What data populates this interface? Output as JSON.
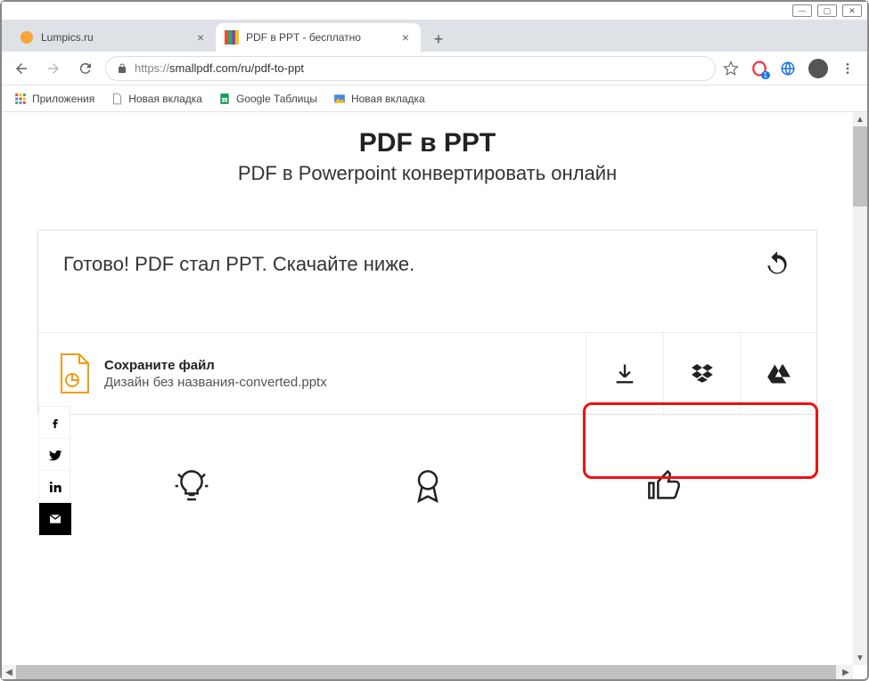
{
  "window": {
    "minimize": "—",
    "maximize": "▢",
    "close": "✕"
  },
  "tabs": [
    {
      "title": "Lumpics.ru"
    },
    {
      "title": "PDF в PPT - бесплатно"
    }
  ],
  "toolbar": {
    "url_prefix": "https://",
    "url_rest": "smallpdf.com/ru/pdf-to-ppt"
  },
  "bookmarks": {
    "apps": "Приложения",
    "newtab1": "Новая вкладка",
    "gsheets": "Google Таблицы",
    "newtab2": "Новая вкладка"
  },
  "page": {
    "title": "PDF в PPT",
    "subtitle": "PDF в Powerpoint конвертировать онлайн",
    "status_message": "Готово! PDF стал PPT. Скачайте ниже.",
    "save_label": "Сохраните файл",
    "filename": "Дизайн без названия-converted.pptx"
  },
  "ext_badge": "1"
}
